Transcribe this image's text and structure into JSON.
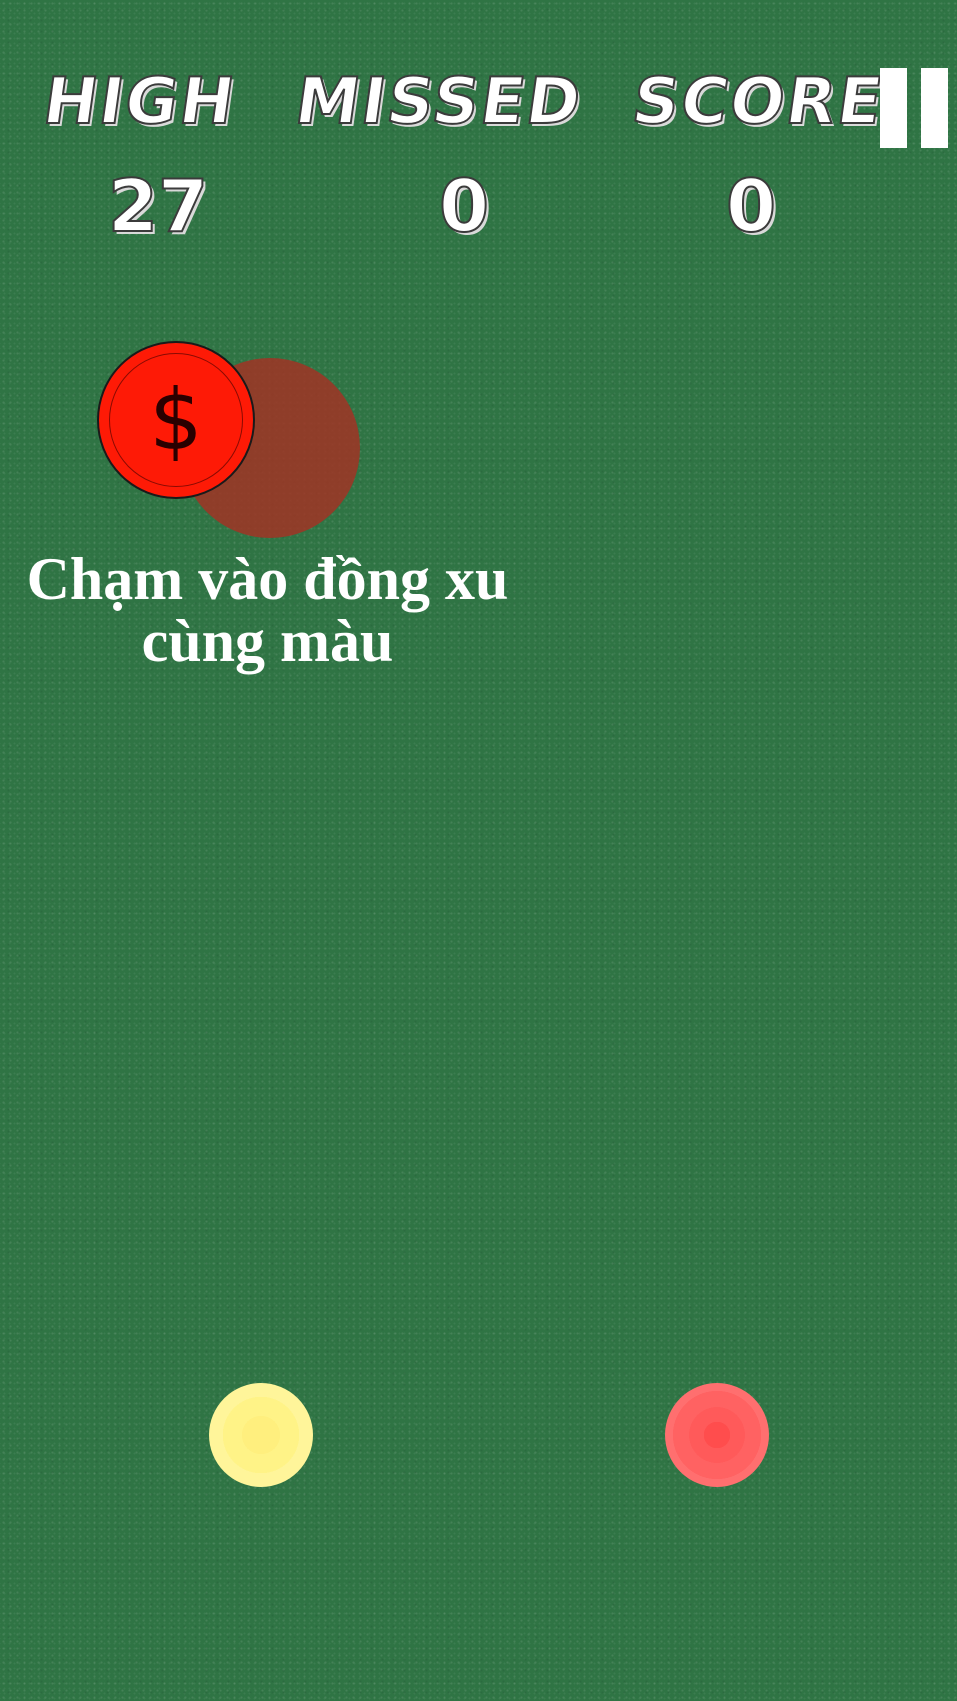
{
  "hud": {
    "high_label": "HIGH",
    "missed_label": "MISSED",
    "score_label": "SCORE",
    "high_value": "27",
    "missed_value": "0",
    "score_value": "0"
  },
  "pause": {
    "icon": "pause-icon"
  },
  "coin": {
    "symbol": "$",
    "color": "#fe1a06",
    "shadow_color": "#a03424"
  },
  "instruction": {
    "line1": "Chạm vào đồng xu",
    "line2": "cùng màu"
  },
  "targets": [
    {
      "name": "yellow-target",
      "color": "#fff387"
    },
    {
      "name": "red-target",
      "color": "#ff5a5a"
    }
  ],
  "colors": {
    "background": "#2f7444",
    "text": "#ffffff"
  }
}
